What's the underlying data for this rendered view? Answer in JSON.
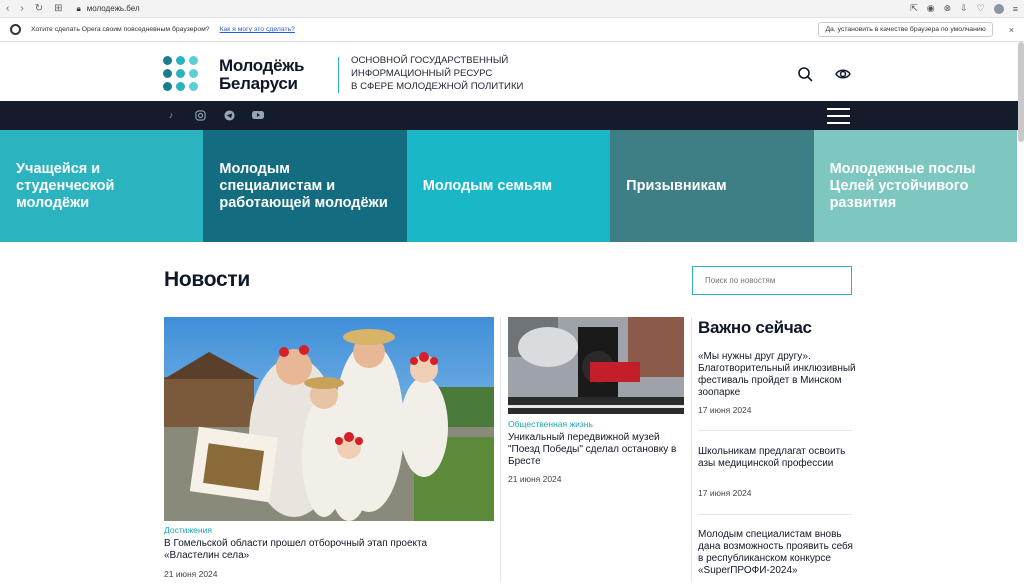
{
  "browser": {
    "url": "молодежь.бел",
    "opera_prompt": "Хотите сделать Opera своим повседневным браузером?",
    "opera_link": "Как я могу это сделать?",
    "opera_button": "Да, установить в качестве браузера по умолчанию",
    "close_glyph": "×"
  },
  "header": {
    "site_name_line1": "Молодёжь",
    "site_name_line2": "Беларуси",
    "tagline_line1": "Основной государственный",
    "tagline_line2": "информационный ресурс",
    "tagline_line3": "в сфере молодежной политики",
    "logo_colors": [
      "#1b7d8c",
      "#2bb3c0",
      "#5bcfd6",
      "#1b7d8c",
      "#2bb3c0",
      "#5bcfd6",
      "#1b7d8c",
      "#2bb3c0",
      "#5bcfd6"
    ]
  },
  "social": [
    "tiktok-icon",
    "instagram-icon",
    "telegram-icon",
    "youtube-icon"
  ],
  "categories": [
    {
      "label": "Учащейся и студенческой молодёжи",
      "color": "#2bb3c0"
    },
    {
      "label": "Молодым специалистам и работающей молодёжи",
      "color": "#136c80"
    },
    {
      "label": "Молодым семьям",
      "color": "#1ab7c8"
    },
    {
      "label": "Призывникам",
      "color": "#3e7e85"
    },
    {
      "label": "Молодежные послы Целей устойчивого развития",
      "color": "#7ec7c1"
    }
  ],
  "news": {
    "title": "Новости",
    "search_placeholder": "Поиск по новостям",
    "main_card": {
      "tag": "Достижения",
      "title": "В Гомельской области прошел отборочный этап проекта «Властелин села»",
      "date": "21 июня 2024"
    },
    "second_card": {
      "tag": "Общественная жизнь",
      "title": "Уникальный передвижной музей \"Поезд Победы\" сделал остановку в Бресте",
      "date": "21 июня 2024"
    }
  },
  "important": {
    "title": "Важно сейчас",
    "items": [
      {
        "title": "«Мы нужны друг другу». Благотворительный инклюзивный фестиваль пройдет в Минском зоопарке",
        "date": "17 июня 2024"
      },
      {
        "title": "Школьникам предлагат освоить азы медицинской профессии",
        "date": "17 июня 2024"
      },
      {
        "title": "Молодым специалистам вновь дана возможность проявить себя в республиканском конкурсе «SuperПРОФИ-2024»",
        "date": ""
      }
    ]
  }
}
